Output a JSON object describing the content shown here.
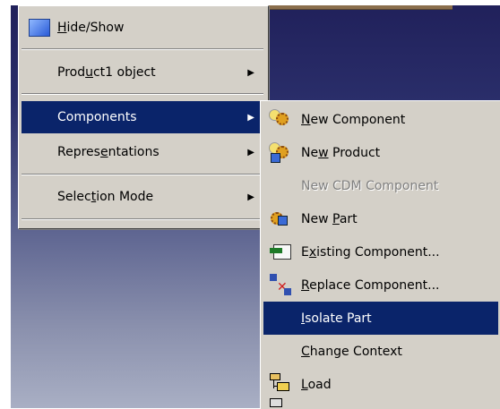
{
  "context_menu": {
    "items": [
      {
        "label_pre": "",
        "mnemonic": "H",
        "label_post": "ide/Show",
        "icon": "hide-show-icon",
        "has_submenu": false
      },
      {
        "label_pre": "Prod",
        "mnemonic": "u",
        "label_post": "ct1 object",
        "has_submenu": true
      },
      {
        "label_pre": "Components",
        "mnemonic": "",
        "label_post": "",
        "has_submenu": true,
        "selected": true
      },
      {
        "label_pre": "Repres",
        "mnemonic": "e",
        "label_post": "ntations",
        "has_submenu": true
      },
      {
        "label_pre": "Selec",
        "mnemonic": "t",
        "label_post": "ion Mode",
        "has_submenu": true
      }
    ],
    "arrow": "▶"
  },
  "submenu": {
    "items": [
      {
        "label_pre": "",
        "mnemonic": "N",
        "label_post": "ew Component",
        "icon": "new-component-icon"
      },
      {
        "label_pre": "Ne",
        "mnemonic": "w",
        "label_post": " Product",
        "icon": "new-product-icon"
      },
      {
        "label_pre": "New CDM Component",
        "mnemonic": "",
        "label_post": "",
        "disabled": true
      },
      {
        "label_pre": "New ",
        "mnemonic": "P",
        "label_post": "art",
        "icon": "new-part-icon"
      },
      {
        "label_pre": "E",
        "mnemonic": "x",
        "label_post": "isting Component...",
        "icon": "existing-component-icon"
      },
      {
        "label_pre": "",
        "mnemonic": "R",
        "label_post": "eplace Component...",
        "icon": "replace-component-icon"
      },
      {
        "label_pre": "",
        "mnemonic": "I",
        "label_post": "solate Part",
        "selected": true
      },
      {
        "label_pre": "",
        "mnemonic": "C",
        "label_post": "hange Context"
      },
      {
        "label_pre": "",
        "mnemonic": "L",
        "label_post": "oad",
        "icon": "load-icon"
      }
    ]
  },
  "colors": {
    "menu_bg": "#d4d0c8",
    "highlight": "#0a246a",
    "viewport_top": "#20205a",
    "viewport_bottom": "#a9afc4"
  }
}
